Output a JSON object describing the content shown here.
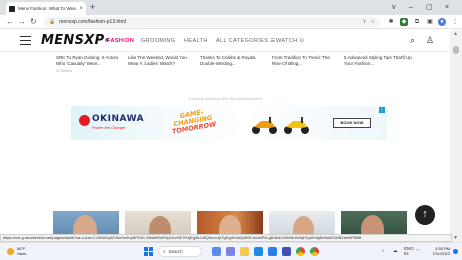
{
  "browser": {
    "tab_title": "Mens Fashion: What To Wear To ...",
    "tab_close": "×",
    "new_tab": "+",
    "url": "mensxp.com/fashion-p13.html",
    "window_controls": [
      "v",
      "–",
      "▢",
      "×"
    ]
  },
  "site": {
    "logo": "MENSXP",
    "logo_mark": "®",
    "nav": [
      "FASHION",
      "GROOMING",
      "HEALTH",
      "ALL CATEGORIES ☰",
      "WATCH ⊙"
    ],
    "articles": [
      {
        "title": "SRK To Ryan Gosling: 5 Actors Who 'Casually' Wear...",
        "meta": "22 Shares"
      },
      {
        "title": "Like The Weeknd, Would You Wear A 'Ladies' Watch?",
        "meta": ""
      },
      {
        "title": "Thanks To Celebs & Royals, Double-Wristing...",
        "meta": ""
      },
      {
        "title": "From Tradition To Trend: The Rise Of Bling...",
        "meta": ""
      },
      {
        "title": "5 Advanced Styling Tips That'll Up Your Fashion...",
        "meta": ""
      }
    ],
    "continue_text": "Continue scrolling after this advertisement",
    "ad": {
      "brand": "OKINAWA",
      "tagline": "Power the Change",
      "headline_1": "GAME-CHANGING",
      "headline_2": "TOMORROW",
      "cta": "BOOK NOW"
    },
    "back_to_top": "↑"
  },
  "status_url": "https://cm.g.doubleclick.net/pagead/aclk?sa=L&ai=CUKMXq4ZVbcHzIfrq3IPh1K-f9ksW5oEHp1KvHE7H4jEgBLIJ8QNcmJpTgEgdV4dQsfM1JsxlxiP4LgB4b4CrkM4bJb5qH1ykK0q8b9m6S1bBXeeNPBBfI",
  "taskbar": {
    "weather_temp": "86°F",
    "weather_desc": "Haze",
    "search": "Search",
    "tray_lang": "ENG",
    "tray_region": "IN",
    "time": "3:35 PM",
    "date": "7/31/2023"
  }
}
